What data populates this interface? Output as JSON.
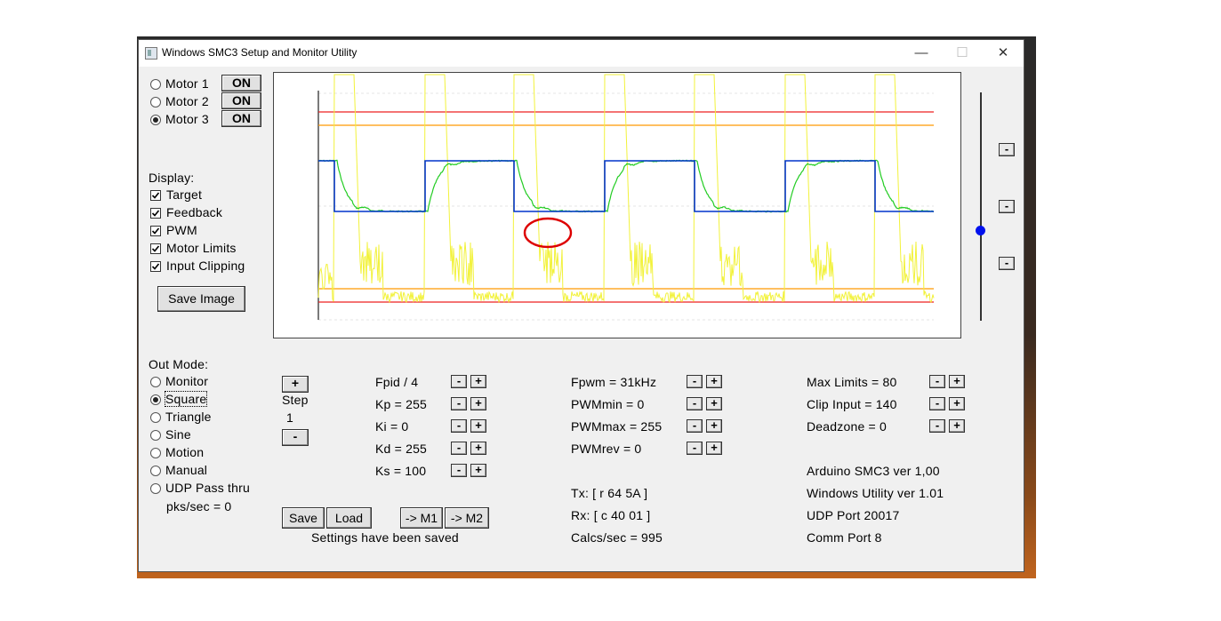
{
  "window": {
    "title": "Windows SMC3 Setup and Monitor Utility",
    "min_glyph": "—",
    "max_glyph": "☐",
    "close_glyph": "✕"
  },
  "motors": [
    {
      "label": "Motor 1",
      "button": "ON",
      "selected": false
    },
    {
      "label": "Motor 2",
      "button": "ON",
      "selected": false
    },
    {
      "label": "Motor 3",
      "button": "ON",
      "selected": true
    }
  ],
  "display": {
    "heading": "Display:",
    "items": [
      {
        "label": "Target",
        "checked": true
      },
      {
        "label": "Feedback",
        "checked": true
      },
      {
        "label": "PWM",
        "checked": true
      },
      {
        "label": "Motor Limits",
        "checked": true
      },
      {
        "label": "Input Clipping",
        "checked": true
      }
    ],
    "save_image": "Save Image"
  },
  "out_mode": {
    "heading": "Out Mode:",
    "options": [
      "Monitor",
      "Square",
      "Triangle",
      "Sine",
      "Motion",
      "Manual",
      "UDP Pass thru"
    ],
    "selected": "Square",
    "pks": "pks/sec = 0"
  },
  "step": {
    "plus": "+",
    "label": "Step",
    "value": "1",
    "minus": "-"
  },
  "pid": [
    "Fpid / 4",
    "Kp = 255",
    "Ki = 0",
    "Kd = 255",
    "Ks = 100"
  ],
  "pwm": [
    "Fpwm = 31kHz",
    "PWMmin = 0",
    "PWMmax = 255",
    "PWMrev = 0"
  ],
  "limits": [
    "Max Limits = 80",
    "Clip Input = 140",
    "Deadzone = 0"
  ],
  "buttons": {
    "save": "Save",
    "load": "Load",
    "to_m1": "-> M1",
    "to_m2": "-> M2"
  },
  "status": "Settings have been saved",
  "comms": {
    "tx": "Tx: [ r 64 5A ]",
    "rx": "Rx: [ c 40 01 ]",
    "calcs": "Calcs/sec = 995"
  },
  "info": [
    "Arduino SMC3 ver 1,00",
    "Windows Utility ver 1.01",
    "UDP Port 20017",
    "Comm Port 8"
  ],
  "small_buttons": {
    "minus": "-",
    "plus": "+"
  },
  "graph": {
    "colors": {
      "target": "#0033cc",
      "feedback": "#22cc22",
      "pwm": "#ffff33",
      "limit": "#ee2222",
      "clip": "#ff9900",
      "highlight": "#dd0000"
    }
  }
}
